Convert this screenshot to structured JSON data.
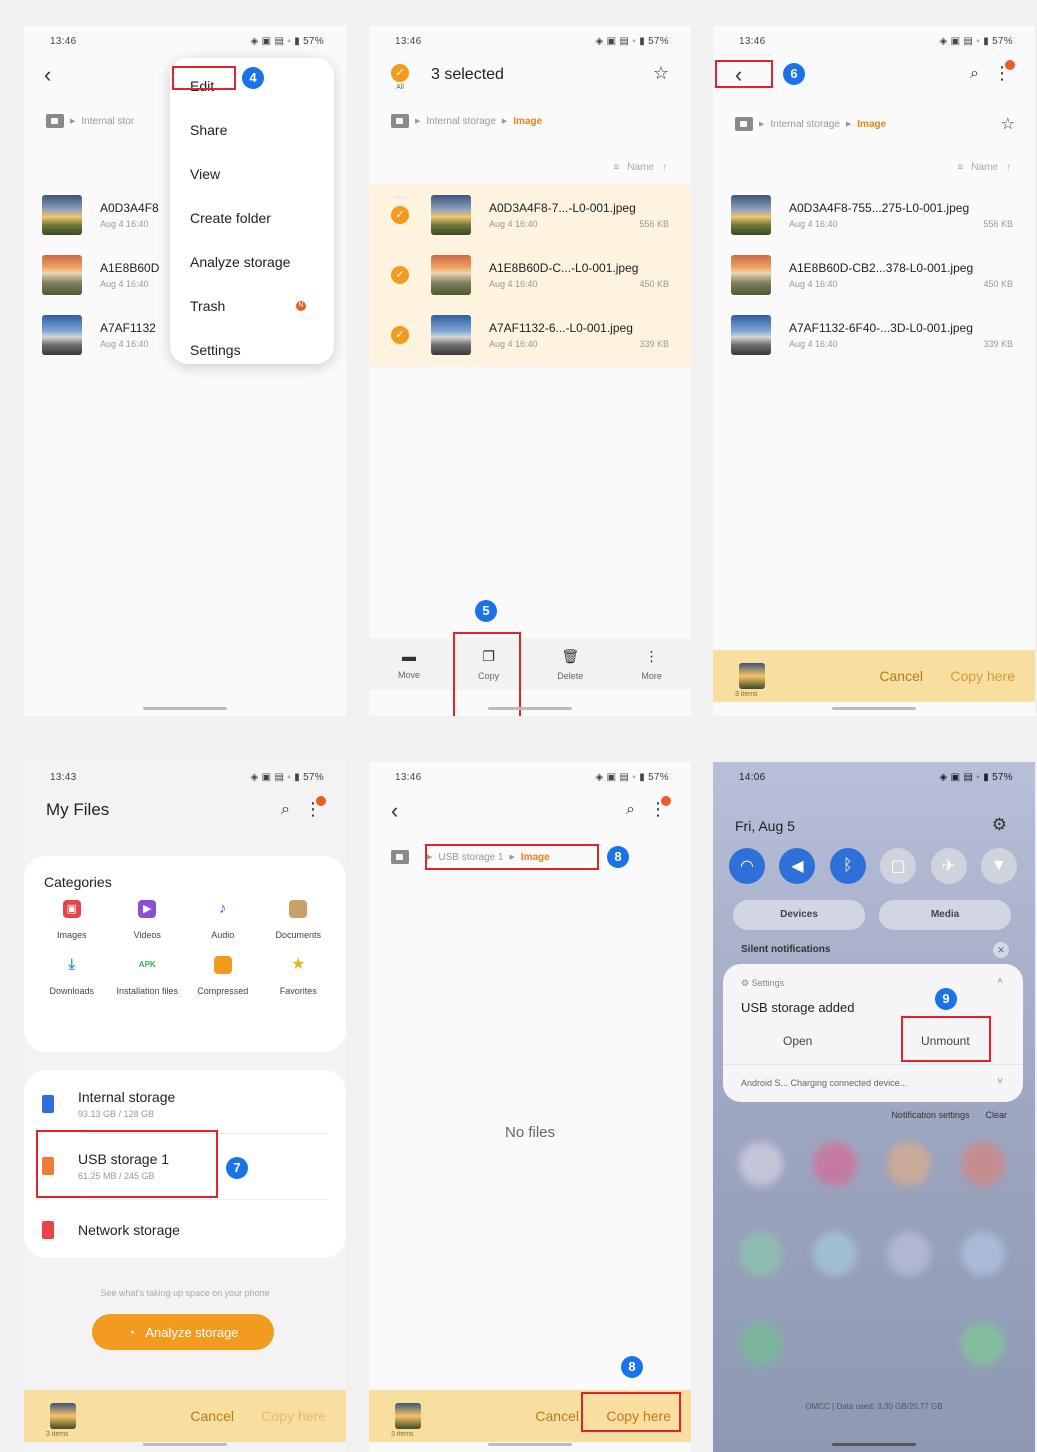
{
  "status_times": [
    "13:46",
    "13:46",
    "13:46",
    "13:43",
    "13:46",
    "14:06"
  ],
  "status_right": "◈ ▣ ▤ ◦ ▮ 57%",
  "panel1": {
    "breadcrumb": "Internal stor",
    "menu": [
      "Edit",
      "Share",
      "View",
      "Create folder",
      "Analyze storage",
      "Trash",
      "Settings"
    ],
    "trash_badge": "N",
    "step": "4"
  },
  "panel2": {
    "selected": "3 selected",
    "all_label": "All",
    "bottom": [
      "Move",
      "Copy",
      "Delete",
      "More"
    ],
    "step": "5"
  },
  "panel3": {
    "step": "6",
    "count_label": "3 items",
    "cancel": "Cancel",
    "copy_here": "Copy here"
  },
  "breadcrumb": {
    "internal": "Internal storage",
    "image": "Image"
  },
  "sort": {
    "name": "Name"
  },
  "files": [
    {
      "short": "A0D3A4F8-7...-L0-001.jpeg",
      "full": "A0D3A4F8-755...275-L0-001.jpeg",
      "p1": "A0D3A4F8",
      "date": "Aug 4 16:40",
      "size": "556 KB"
    },
    {
      "short": "A1E8B60D-C...-L0-001.jpeg",
      "full": "A1E8B60D-CB2...378-L0-001.jpeg",
      "p1": "A1E8B60D",
      "date": "Aug 4 16:40",
      "size": "450 KB"
    },
    {
      "short": "A7AF1132-6...-L0-001.jpeg",
      "full": "A7AF1132-6F40-...3D-L0-001.jpeg",
      "p1": "A7AF1132",
      "date": "Aug 4 16:40",
      "size": "339 KB"
    }
  ],
  "panel4": {
    "title": "My Files",
    "categories_title": "Categories",
    "categories": [
      "Images",
      "Videos",
      "Audio",
      "Documents",
      "Downloads",
      "Installation files",
      "Compressed",
      "Favorites"
    ],
    "apk": "APK",
    "internal_name": "Internal storage",
    "internal_sub": "93.13 GB / 128 GB",
    "usb_name": "USB storage 1",
    "usb_sub": "61.25 MB / 245 GB",
    "network_name": "Network storage",
    "hint": "See what's taking up space on your phone",
    "analyze": "Analyze storage",
    "step": "7"
  },
  "panel5": {
    "crumb_usb": "USB storage 1",
    "empty": "No files",
    "step": "8"
  },
  "panel6": {
    "date": "Fri, Aug 5",
    "devices": "Devices",
    "media": "Media",
    "silent": "Silent notifications",
    "app": "Settings",
    "notif_title": "USB storage added",
    "open": "Open",
    "unmount": "Unmount",
    "sub_notif": "Android S...   Charging connected device...",
    "notif_settings": "Notification settings",
    "clear": "Clear",
    "carrier": "OMCC | Data used: 3.30 GB/20.77 GB",
    "step": "9"
  },
  "colors": {
    "accent": "#f29b1f",
    "highlight": "#e2242a",
    "step": "#1a73e8",
    "copy_bar": "#f8dfa0"
  }
}
